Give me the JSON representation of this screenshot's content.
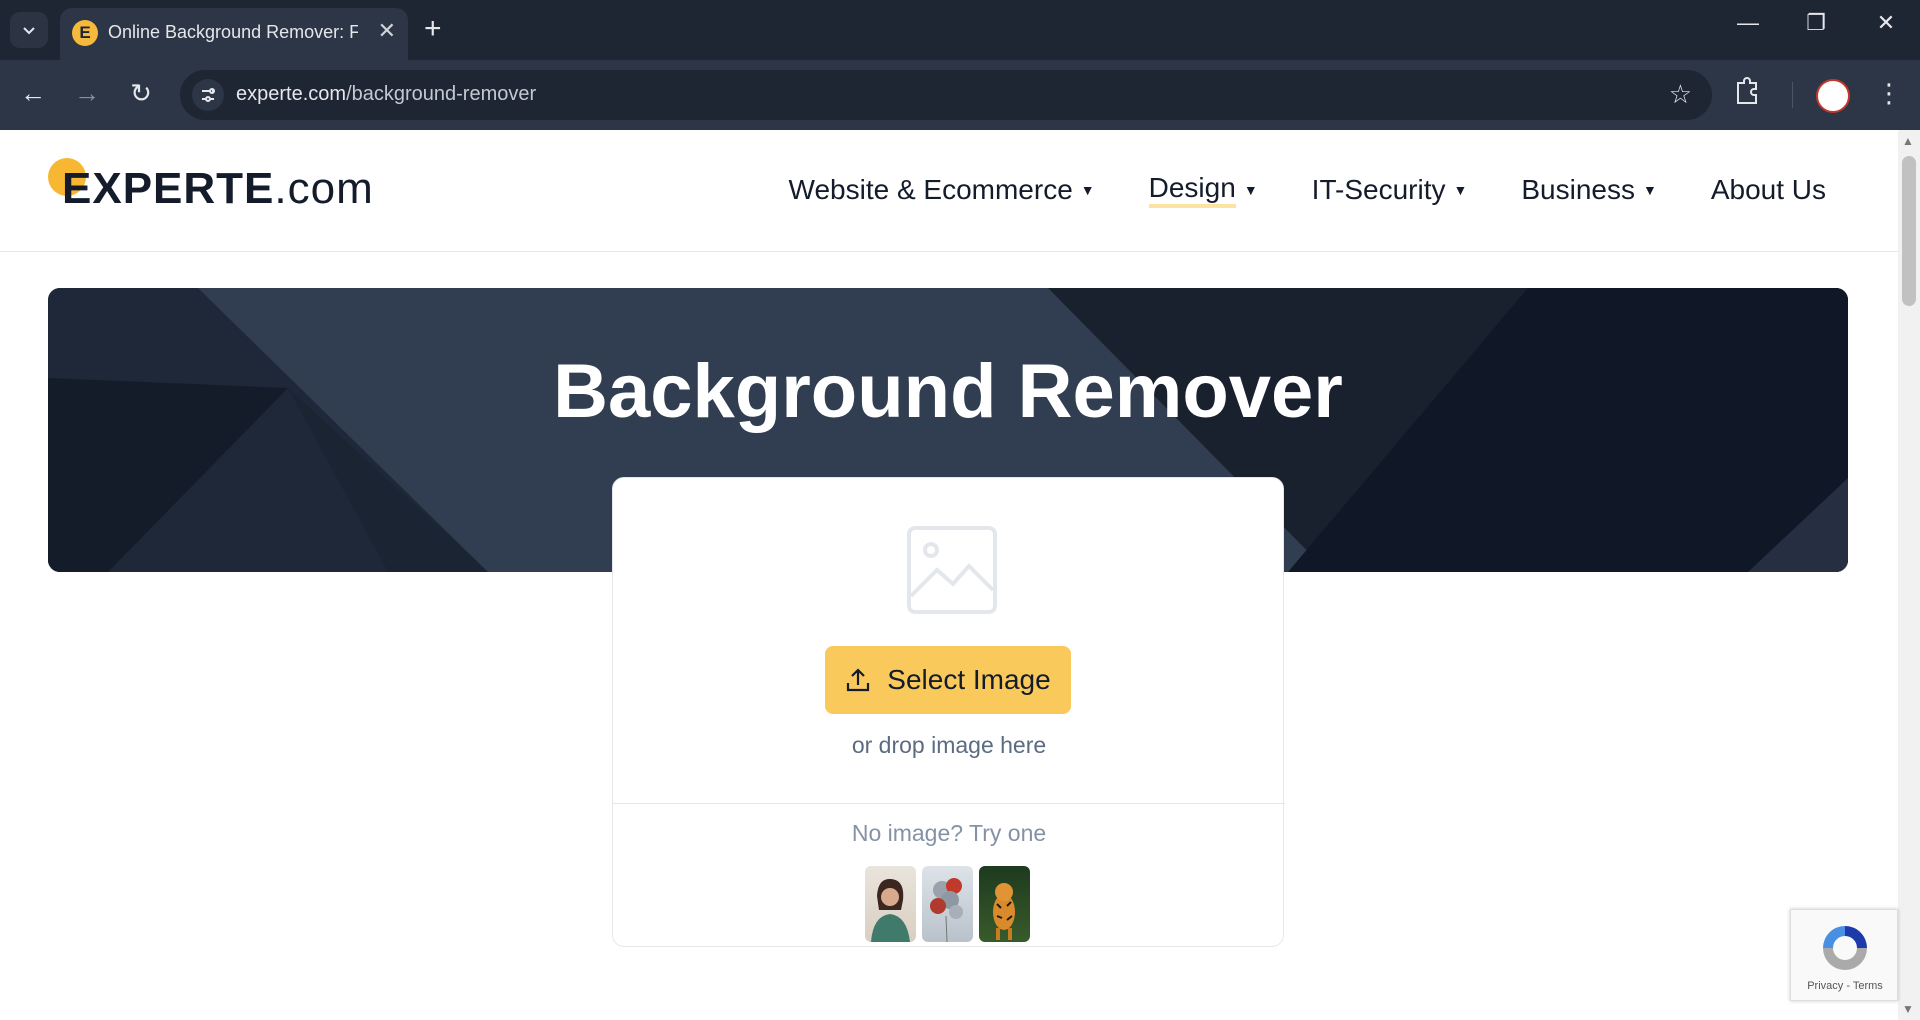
{
  "browser": {
    "tab_title": "Online Background Remover: Fr",
    "url_domain": "experte.com",
    "url_path": "/background-remover",
    "new_tab_label": "+",
    "close_label": "✕"
  },
  "site": {
    "logo_main": "EXPERTE",
    "logo_suffix": ".com",
    "accent_color": "#f7b733",
    "nav": [
      {
        "label": "Website & Ecommerce",
        "dropdown": true
      },
      {
        "label": "Design",
        "dropdown": true,
        "active": true
      },
      {
        "label": "IT-Security",
        "dropdown": true
      },
      {
        "label": "Business",
        "dropdown": true
      },
      {
        "label": "About Us",
        "dropdown": false
      }
    ]
  },
  "hero": {
    "title": "Background Remover"
  },
  "upload": {
    "button_label": "Select Image",
    "drop_text": "or drop image here",
    "try_text": "No image? Try one",
    "samples": [
      "woman-portrait",
      "balloons",
      "tiger"
    ]
  },
  "recaptcha": {
    "text": "Privacy - Terms"
  }
}
